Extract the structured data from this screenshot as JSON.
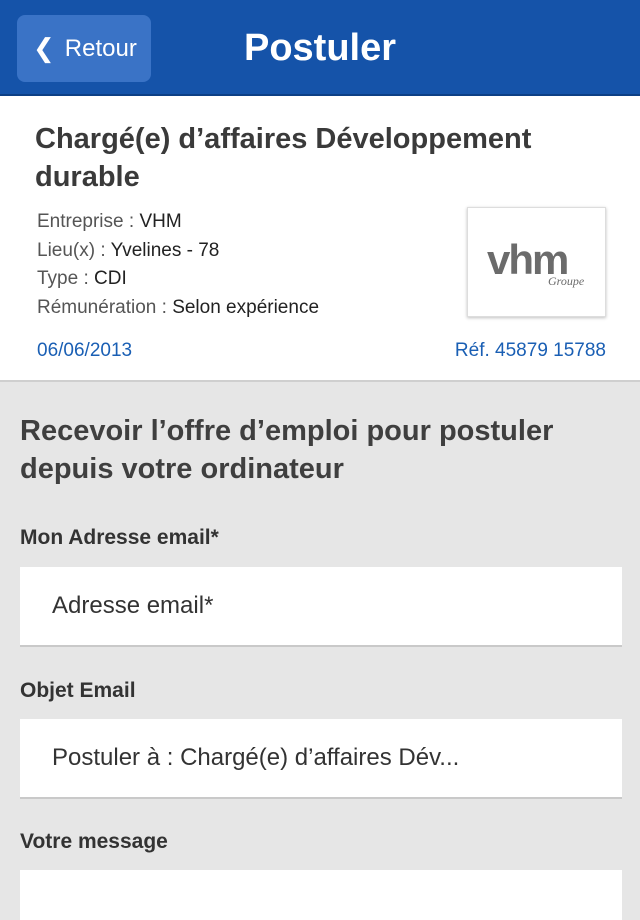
{
  "nav": {
    "back_label": "Retour",
    "title": "Postuler"
  },
  "job": {
    "title": "Chargé(e) d’affaires Développement durable",
    "company_key": "Entreprise : ",
    "company": "VHM",
    "location_key": "Lieu(x) : ",
    "location": "Yvelines - 78",
    "type_key": "Type : ",
    "type": "CDI",
    "salary_key": "Rémunération : ",
    "salary": "Selon expérience",
    "date": "06/06/2013",
    "ref": "Réf. 45879 15788",
    "logo": {
      "word": "vhm",
      "sub": "Groupe"
    }
  },
  "form": {
    "heading": "Recevoir l’offre d’emploi pour postuler depuis votre ordinateur",
    "email_label": "Mon Adresse email*",
    "email_placeholder": "Adresse email*",
    "subject_label": "Objet Email",
    "subject_value": "Postuler à : Chargé(e) d’affaires Dév...",
    "message_label": "Votre message",
    "message_value": ""
  },
  "colors": {
    "nav_bg": "#1553a9",
    "accent_blue": "#1a5fb4"
  }
}
